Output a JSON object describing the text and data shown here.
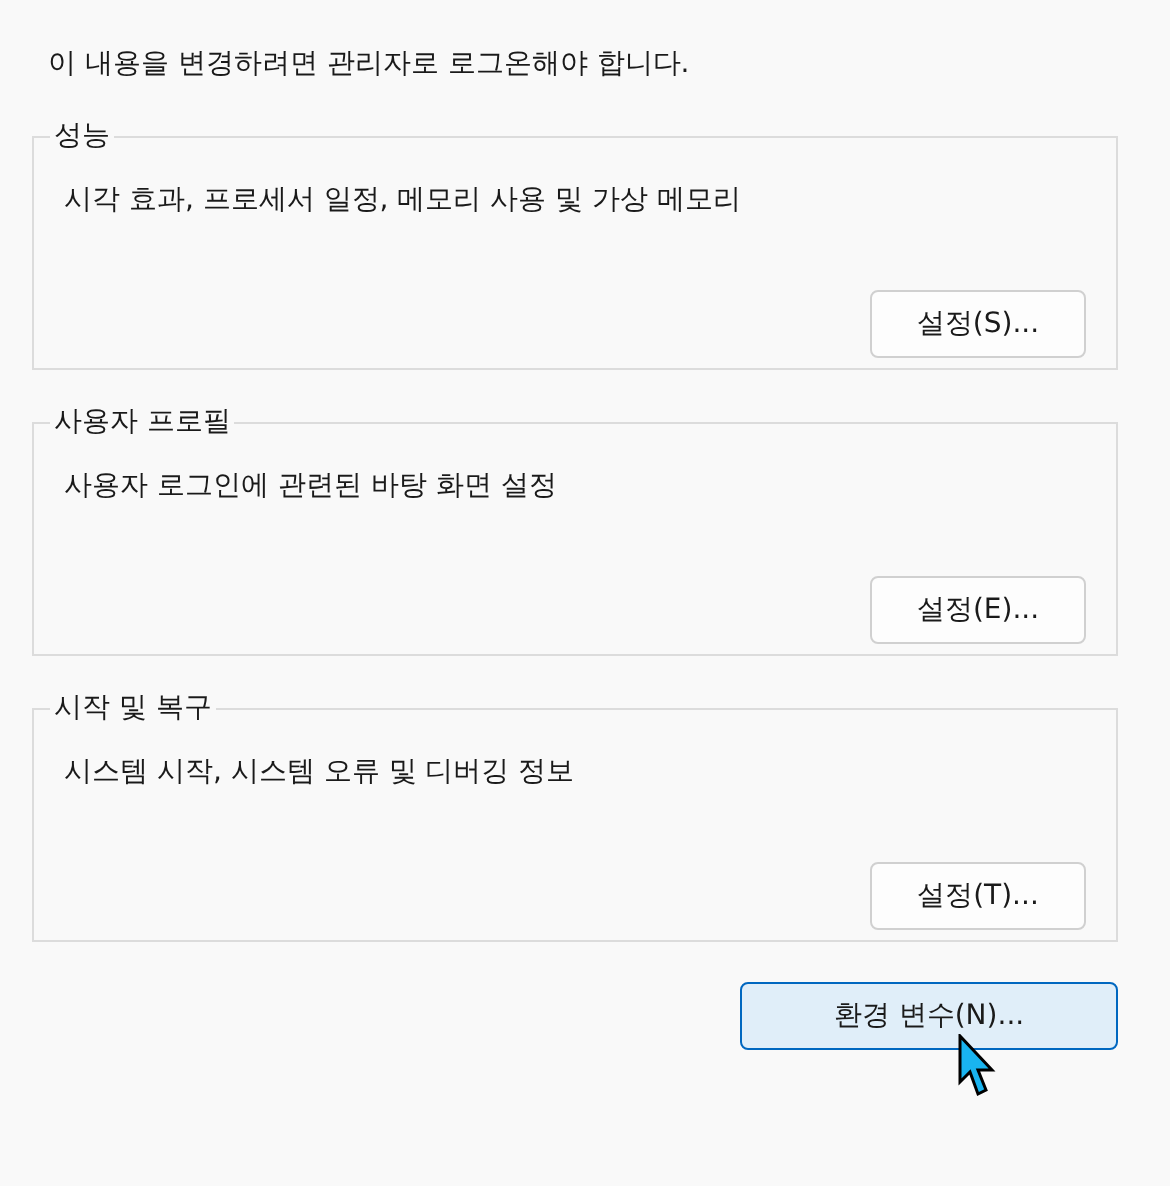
{
  "notice": "이 내용을 변경하려면 관리자로 로그온해야 합니다.",
  "groups": [
    {
      "title": "성능",
      "description": "시각 효과, 프로세서 일정, 메모리 사용 및 가상 메모리",
      "button": "설정(S)..."
    },
    {
      "title": "사용자 프로필",
      "description": "사용자 로그인에 관련된 바탕 화면 설정",
      "button": "설정(E)..."
    },
    {
      "title": "시작 및 복구",
      "description": "시스템 시작, 시스템 오류 및 디버깅 정보",
      "button": "설정(T)..."
    }
  ],
  "footer_button": {
    "label": "환경 변수(N)...",
    "hovered": true
  }
}
